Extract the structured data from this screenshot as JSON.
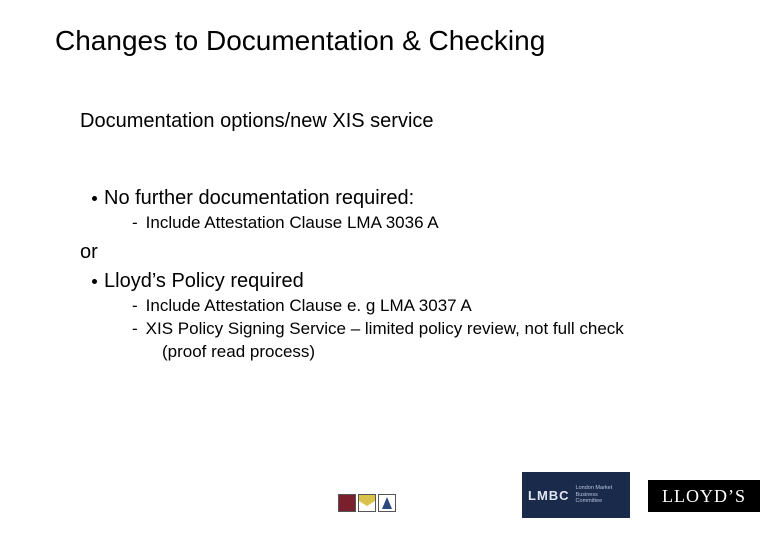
{
  "title": "Changes to Documentation & Checking",
  "subtitle": "Documentation options/new XIS service",
  "bullets": {
    "b1": "No further documentation required:",
    "b1s1": "Include Attestation Clause LMA 3036 A",
    "or": "or",
    "b2": "Lloyd’s Policy required",
    "b2s1": "Include Attestation Clause e. g LMA 3037 A",
    "b2s2": "XIS Policy Signing Service – limited policy review, not full check",
    "b2s2b": "(proof read process)"
  },
  "logos": {
    "lmbc_label": "LMBC",
    "lmbc_small": "London Market Business Committee",
    "lloyds": "LLOYD’S"
  }
}
